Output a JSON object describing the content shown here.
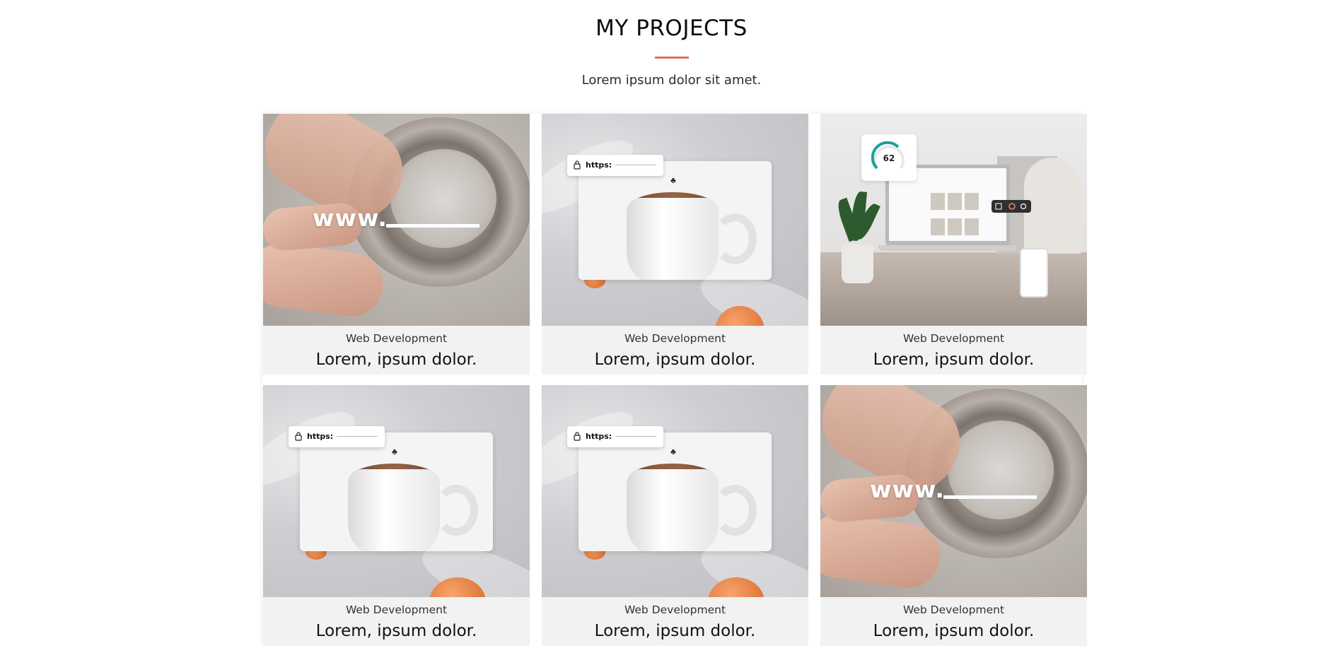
{
  "section": {
    "title": "MY PROJECTS",
    "subtitle": "Lorem ipsum dolor sit amet.",
    "accent_color": "#e06b63"
  },
  "projects": [
    {
      "category": "Web Development",
      "name": "Lorem, ipsum dolor.",
      "image": "pottery",
      "image_text": "www."
    },
    {
      "category": "Web Development",
      "name": "Lorem, ipsum dolor.",
      "image": "mug-browser",
      "url_text": "https:"
    },
    {
      "category": "Web Development",
      "name": "Lorem, ipsum dolor.",
      "image": "laptop-mockup",
      "gauge_value": "62"
    },
    {
      "category": "Web Development",
      "name": "Lorem, ipsum dolor.",
      "image": "mug-browser",
      "url_text": "https:"
    },
    {
      "category": "Web Development",
      "name": "Lorem, ipsum dolor.",
      "image": "mug-browser",
      "url_text": "https:"
    },
    {
      "category": "Web Development",
      "name": "Lorem, ipsum dolor.",
      "image": "pottery",
      "image_text": "www."
    }
  ]
}
